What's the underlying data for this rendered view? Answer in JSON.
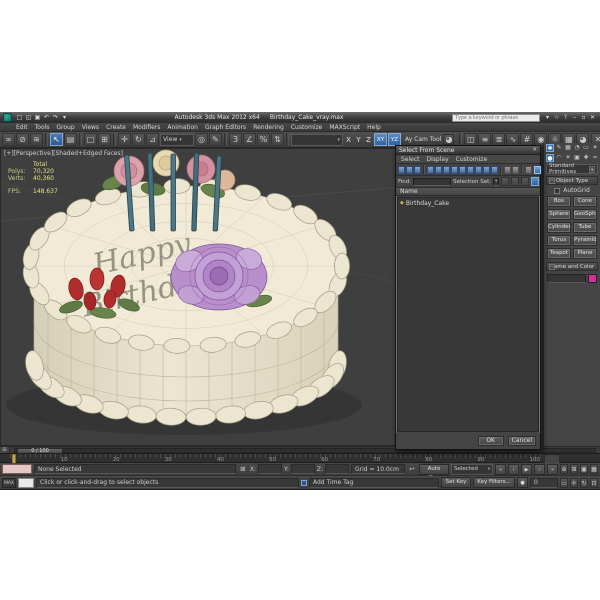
{
  "window": {
    "title_app": "Autodesk 3ds Max 2012 x64",
    "title_file": "Birthday_Cake_vray.max",
    "search_placeholder": "Type a keyword or phrase"
  },
  "menubar": {
    "items": [
      "Edit",
      "Tools",
      "Group",
      "Views",
      "Create",
      "Modifiers",
      "Animation",
      "Graph Editors",
      "Rendering",
      "Customize",
      "MAXScript",
      "Help"
    ]
  },
  "toolbar": {
    "ref_coord": "View",
    "axis_x": "X",
    "axis_y": "Y",
    "axis_z": "Z",
    "constraint_xy": "XY",
    "constraint_yz": "YZ",
    "cam_tool": "Ay Cam Tool"
  },
  "viewport": {
    "label": "[+][Perspective][Shaded+Edged Faces]",
    "stats": {
      "total": "Total",
      "polys_label": "Polys:",
      "polys": "70,320",
      "verts_label": "Verts:",
      "verts": "40,360",
      "fps_label": "FPS:",
      "fps": "148.637"
    },
    "cake_line1": "Happy",
    "cake_line2": "Birthday"
  },
  "dialog": {
    "title": "Select From Scene",
    "menu_select": "Select",
    "menu_display": "Display",
    "menu_customize": "Customize",
    "find_label": "Find:",
    "selection_set_label": "Selection Set:",
    "name_header": "Name",
    "item": "Birthday_Cake",
    "ok": "OK",
    "cancel": "Cancel"
  },
  "panel": {
    "dropdown": "Standard Primitives",
    "object_type": "Object Type",
    "autogrid": "AutoGrid",
    "buttons": [
      "Box",
      "Cone",
      "Sphere",
      "GeoSphere",
      "Cylinder",
      "Tube",
      "Torus",
      "Pyramid",
      "Teapot",
      "Plane"
    ],
    "name_color": "Name and Color",
    "object_color": "#d6309a"
  },
  "timeline": {
    "slider": "0 / 100",
    "ticks": [
      "0",
      "10",
      "20",
      "30",
      "40",
      "50",
      "60",
      "70",
      "80",
      "90",
      "100"
    ]
  },
  "statusbar": {
    "maxscript": "MAX",
    "status": "None Selected",
    "prompt": "Click or click-and-drag to select objects",
    "x": "X:",
    "y": "Y:",
    "z": "Z:",
    "grid": "Grid = 10.0cm",
    "add_time_tag": "Add Time Tag",
    "auto_key": "Auto Key",
    "set_key": "Set Key",
    "selected": "Selected",
    "key_filters": "Key Filters...",
    "frame": "0"
  },
  "icons": {
    "new_file": "□",
    "open_file": "◱",
    "save_file": "▣",
    "undo": "↶",
    "redo": "↷",
    "flyout": "▾",
    "link": "∞",
    "unlink": "⊘",
    "bind_warp": "≋",
    "select": "↖",
    "select_by_name": "▤",
    "region": "□",
    "win_cross": "⊞",
    "move": "✛",
    "rotate": "↻",
    "scale": "⊿",
    "pivot": "◎",
    "manipulate": "✎",
    "snap_3d": "3",
    "snap_angle": "∠",
    "snap_percent": "%",
    "snap_spinner": "⇅",
    "mirror": "◫",
    "align": "≡",
    "layers": "≣",
    "curve": "∿",
    "schematic": "#",
    "material": "◉",
    "render_setup": "☼",
    "render_frame": "▦",
    "render": "◕",
    "min": "‒",
    "restore": "▫",
    "close": "✕",
    "help": "?",
    "star": "☆",
    "caret": "▾",
    "lock": "⊠",
    "back_arrow": "↩",
    "mini_curve": "⊞",
    "go_start": "«",
    "prev": "‹",
    "play": "▶",
    "next": "›",
    "go_end": "»",
    "key_mode": "●",
    "zoom": "⊕",
    "zoom_all": "⊞",
    "extents": "▣",
    "extents_all": "▦",
    "zoom_region": "▭",
    "pan": "✛",
    "orbit": "↻",
    "maximize": "⊡",
    "tab_create": "✱",
    "tab_modify": "✎",
    "tab_hierarchy": "▦",
    "tab_motion": "◔",
    "tab_display": "▭",
    "tab_utilities": "✶",
    "cat_geometry": "●",
    "cat_shapes": "◠",
    "cat_lights": "☀",
    "cat_cameras": "▣",
    "cat_helpers": "✚",
    "cat_warps": "≈",
    "cat_systems": "⊛",
    "item_geom": "◆"
  }
}
